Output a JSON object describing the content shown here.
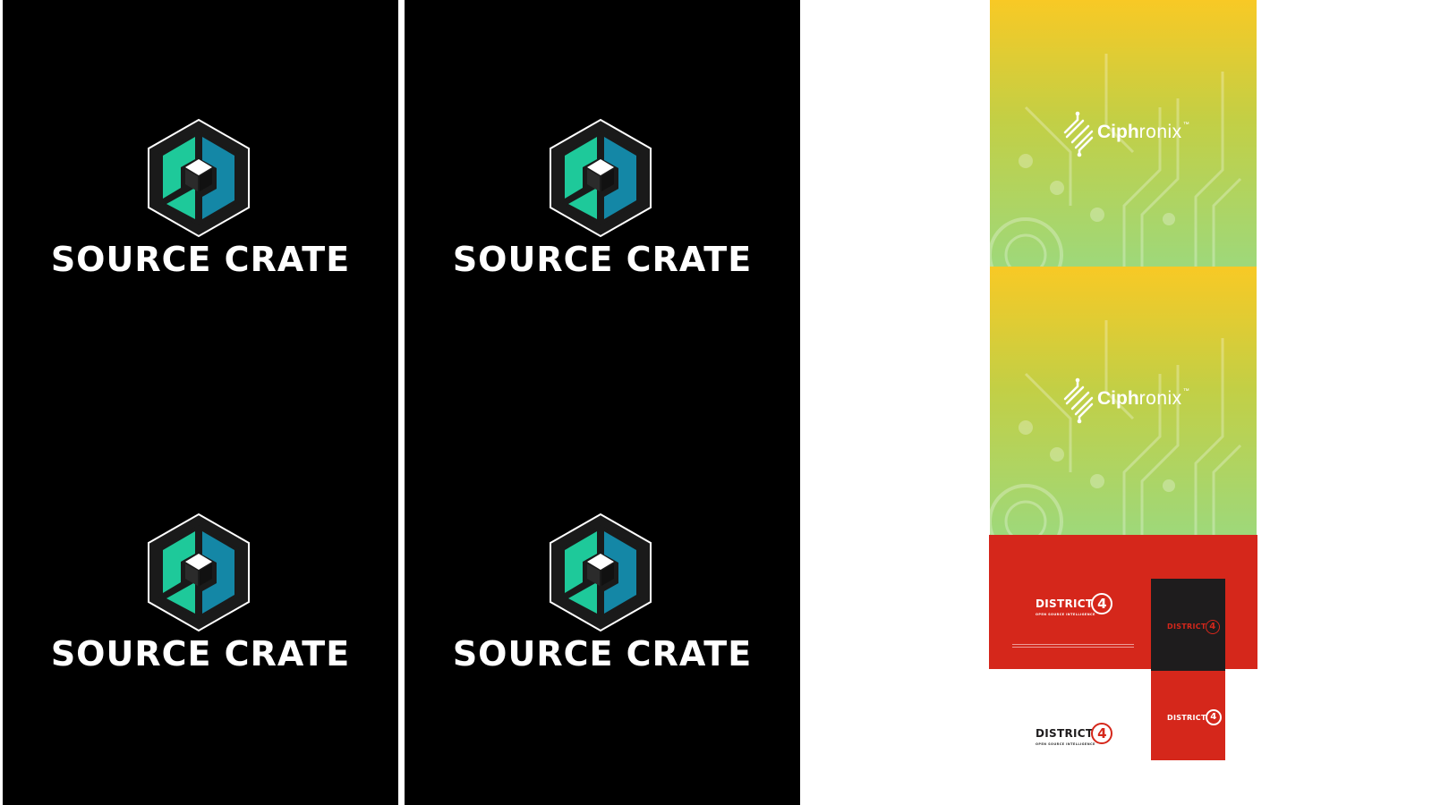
{
  "colors": {
    "panel_background": "#000000",
    "source_crate_green": "#1ec99a",
    "source_crate_blue": "#1487a6",
    "ciphronix_gradient_top": "#f8c925",
    "ciphronix_gradient_bottom": "#9ed87a",
    "district4_red": "#d5271b",
    "district4_dark": "#1e1c1d"
  },
  "source_crate": {
    "icon": "hexagon-crate-icon",
    "wordmark": "SOURCE CRATE"
  },
  "ciphronix": {
    "icon": "ciphronix-circuit-icon",
    "name_bold": "Ciph",
    "name_light": "ronix",
    "trademark": "™"
  },
  "district4": {
    "word": "DISTRICT",
    "number": "4",
    "tagline": "OPEN SOURCE INTELLIGENCE"
  }
}
